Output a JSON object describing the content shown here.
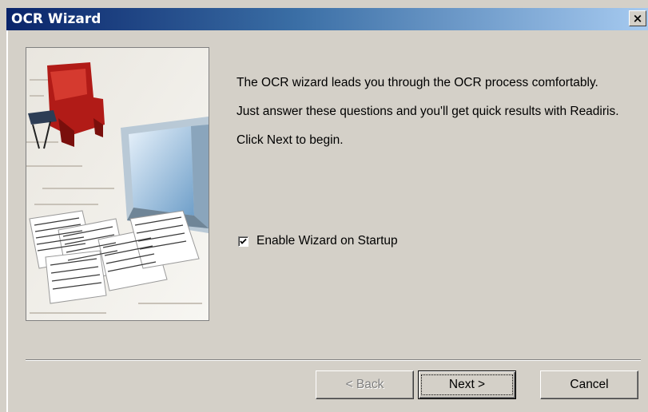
{
  "window": {
    "title": "OCR Wizard",
    "close_label": "×"
  },
  "content": {
    "paragraphs": [
      "The OCR wizard leads you through the OCR process comfortably.",
      "Just answer these questions and you'll get quick results with Readiris.",
      "Click Next to begin."
    ],
    "checkbox": {
      "label": "Enable Wizard on Startup",
      "checked": true
    }
  },
  "buttons": {
    "back": "< Back",
    "next": "Next >",
    "cancel": "Cancel"
  },
  "colors": {
    "title_bar_start": "#0a246a",
    "title_bar_end": "#a6caf0",
    "dialog_bg": "#d4d0c8"
  },
  "icons": {
    "close": "close-icon",
    "checkmark": "checkmark-icon"
  }
}
